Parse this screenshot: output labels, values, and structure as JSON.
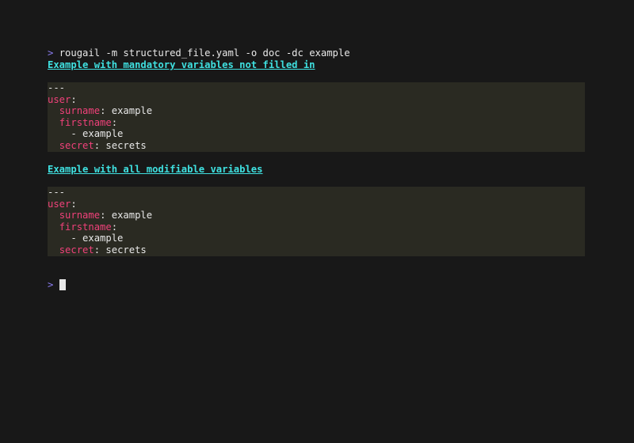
{
  "terminal": {
    "prompt_symbol": ">",
    "command": "rougail -m structured_file.yaml -o doc -dc example",
    "sections": [
      {
        "heading": "Example with mandatory variables not filled in",
        "doc_start": "---",
        "root_key": "user",
        "surname_key": "surname",
        "surname_value": "example",
        "firstname_key": "firstname",
        "firstname_item": "- example",
        "secret_key": "secret",
        "secret_value": "secrets"
      },
      {
        "heading": "Example with all modifiable variables",
        "doc_start": "---",
        "root_key": "user",
        "surname_key": "surname",
        "surname_value": "example",
        "firstname_key": "firstname",
        "firstname_item": "- example",
        "secret_key": "secret",
        "secret_value": "secrets"
      }
    ],
    "colors": {
      "background": "#181818",
      "prompt": "#8a7cf0",
      "heading": "#3fe0e0",
      "yaml_key": "#f0417a",
      "code_background": "#2a2a22"
    }
  }
}
